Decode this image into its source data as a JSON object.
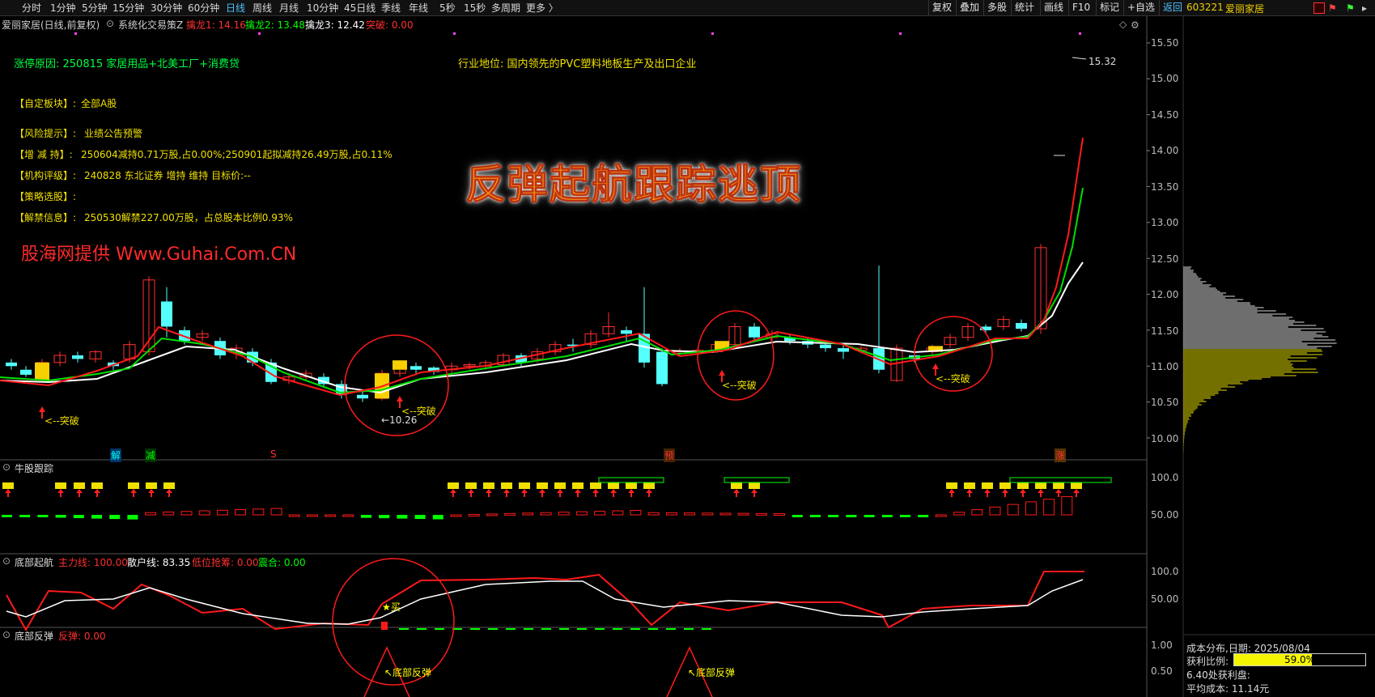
{
  "toolbar": {
    "periods": [
      "分时",
      "1分钟",
      "5分钟",
      "15分钟",
      "30分钟",
      "60分钟",
      "日线",
      "周线",
      "月线",
      "10分钟",
      "45日线",
      "季线",
      "年线",
      "5秒",
      "15秒",
      "多周期",
      "更多 〉"
    ],
    "active_period": "日线",
    "tools": [
      "复权",
      "叠加",
      "多股",
      "统计",
      "画线",
      "F10",
      "标记",
      "+自选",
      "返回"
    ],
    "stock_code": "603221",
    "stock_name": "爱丽家居"
  },
  "main_panel": {
    "title": "爱丽家居(日线,前复权)",
    "indicator": "系统化交易策Z",
    "q1": "擒龙1: 14.16",
    "q2": "擒龙2: 13.48",
    "q3": "擒龙3: 12.42",
    "tupo": "突破: 0.00",
    "reason": "涨停原因: 250815 家居用品+北美工厂+消费贷",
    "position": "行业地位: 国内领先的PVC塑料地板生产及出口企业",
    "info": [
      {
        "label": "【自定板块】:",
        "value": "全部A股"
      },
      {
        "label": "【风险提示】:",
        "value": "业绩公告预警"
      },
      {
        "label": "【增 减 持】:",
        "value": "250604减持0.71万股,占0.00%;250901起拟减持26.49万股,占0.11%"
      },
      {
        "label": "【机构评级】:",
        "value": "240828 东北证券 增持 维持 目标价:--"
      },
      {
        "label": "【策略选股】:",
        "value": ""
      },
      {
        "label": "【解禁信息】:",
        "value": "250530解禁227.00万股，占总股本比例0.93%"
      }
    ],
    "big_title": "反弹起航跟踪逃顶",
    "watermark": "股海网提供 Www.Guhai.Com.CN",
    "high_label": "15.32",
    "low_label": "←10.26",
    "breakout_label": "<--突破",
    "markers": [
      "解",
      "减",
      "S",
      "预",
      "涨"
    ],
    "y_ticks": [
      "15.50",
      "15.00",
      "14.50",
      "14.00",
      "13.50",
      "13.00",
      "12.50",
      "12.00",
      "11.50",
      "11.00",
      "10.50",
      "10.00"
    ]
  },
  "panel2": {
    "title": "牛股跟踪",
    "y_ticks": [
      "100.0",
      "50.00"
    ]
  },
  "panel3": {
    "title": "底部起航",
    "zhuli": "主力线: 100.00",
    "sanhu": "散户线: 83.35",
    "diwei": "低位抢筹: 0.00",
    "zhenhe": "震合: 0.00",
    "buy_label": "★买",
    "y_ticks": [
      "100.0",
      "50.00"
    ]
  },
  "panel4": {
    "title": "底部反弹",
    "fantan": "反弹: 0.00",
    "label": "↖底部反弹",
    "y_ticks": [
      "1.00",
      "0.50"
    ]
  },
  "cost_panel": {
    "title": "成本分布,日期: 2025/08/04",
    "profit_label": "获利比例:",
    "profit_value": "59.0%",
    "profit_ratio": 0.59,
    "chip_text": "6.40处获利盘:",
    "avg_cost": "平均成本: 11.14元"
  },
  "colors": {
    "up": "#ff3030",
    "down": "#54ffff",
    "ma_white": "#ffffff",
    "ma_green": "#00e000",
    "ma_red": "#ff1a1a",
    "label_yellow": "#f0e000",
    "bg": "#000000"
  }
}
